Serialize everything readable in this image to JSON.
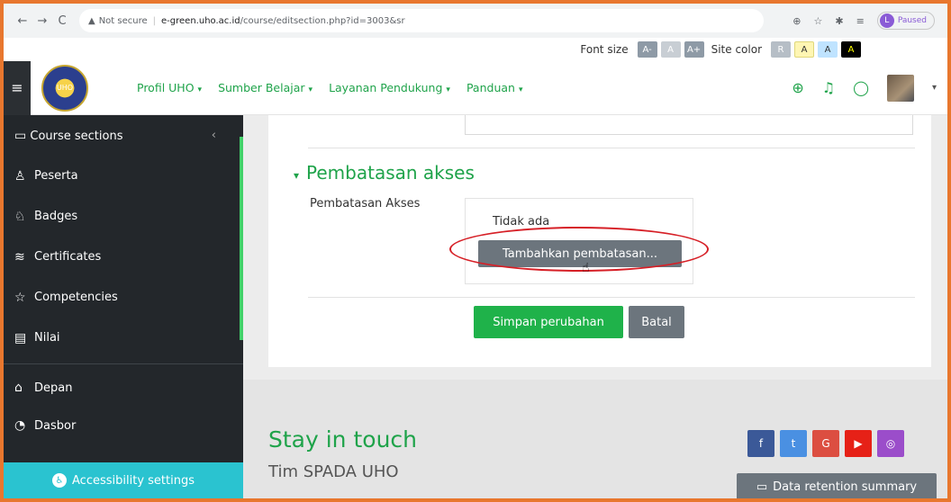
{
  "browser": {
    "back": "←",
    "forward": "→",
    "reload": "C",
    "security": "Not secure",
    "url_host": "e-green.uho.ac.id",
    "url_path": "/course/editsection.php?id=3003&sr",
    "paused_label": "Paused",
    "paused_initial": "L"
  },
  "accessibility_bar": {
    "font_size_label": "Font size",
    "font_buttons": [
      "A-",
      "A",
      "A+"
    ],
    "site_color_label": "Site color",
    "color_buttons": [
      "R",
      "A",
      "A",
      "A"
    ]
  },
  "navbar": {
    "menu": [
      "Profil UHO",
      "Sumber Belajar",
      "Layanan Pendukung",
      "Panduan"
    ],
    "logo_text": "UHO"
  },
  "sidebar": {
    "items": [
      {
        "label": "Course sections",
        "icon": "folder-icon"
      },
      {
        "label": "Peserta",
        "icon": "users-icon"
      },
      {
        "label": "Badges",
        "icon": "badge-icon"
      },
      {
        "label": "Certificates",
        "icon": "certificate-icon"
      },
      {
        "label": "Competencies",
        "icon": "star-icon"
      },
      {
        "label": "Nilai",
        "icon": "table-icon"
      },
      {
        "label": "Depan",
        "icon": "home-icon"
      },
      {
        "label": "Dasbor",
        "icon": "dashboard-icon"
      }
    ],
    "accessibility_button": "Accessibility settings"
  },
  "section": {
    "title": "Pembatasan akses",
    "field_label": "Pembatasan Akses",
    "none_text": "Tidak ada",
    "add_restriction": "Tambahkan pembatasan...",
    "save": "Simpan perubahan",
    "cancel": "Batal"
  },
  "footer": {
    "stay": "Stay in touch",
    "team": "Tim SPADA UHO",
    "retention": "Data retention summary",
    "social": [
      {
        "icon": "facebook-icon",
        "color": "#3b5998",
        "glyph": "f"
      },
      {
        "icon": "twitter-icon",
        "color": "#4a90e2",
        "glyph": "t"
      },
      {
        "icon": "google-icon",
        "color": "#dc4e41",
        "glyph": "G"
      },
      {
        "icon": "youtube-icon",
        "color": "#e62117",
        "glyph": "▶"
      },
      {
        "icon": "instagram-icon",
        "color": "#9b4dca",
        "glyph": "◎"
      }
    ]
  },
  "colors": {
    "accent": "#1fa34a",
    "sidebar": "#23272b",
    "annotation": "#d61f26"
  }
}
